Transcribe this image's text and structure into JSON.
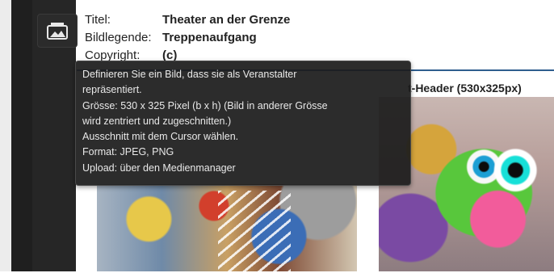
{
  "meta": {
    "title_label": "Titel:",
    "title_value": "Theater an der Grenze",
    "legend_label": "Bildlegende:",
    "legend_value": "Treppenaufgang",
    "copyright_label": "Copyright:",
    "copyright_value": "(c)"
  },
  "toolbar": {
    "image_tool_icon": "image-gallery-icon"
  },
  "tooltip": {
    "lines": [
      "Definieren Sie ein Bild, dass sie als Veranstalter",
      "repräsentiert.",
      "Grösse: 530 x 325 Pixel (b x h) (Bild in anderer Grösse",
      "wird zentriert und zugeschnitten.)",
      "Ausschnitt mit dem Cursor wählen.",
      "Format: JPEG, PNG",
      "Upload: über den Medienmanager"
    ]
  },
  "panel": {
    "right_image_title": "t-Header (530x325px)"
  },
  "colors": {
    "tooltip_bg": "#1c1c1c",
    "panel_border": "#2f5e8e"
  }
}
